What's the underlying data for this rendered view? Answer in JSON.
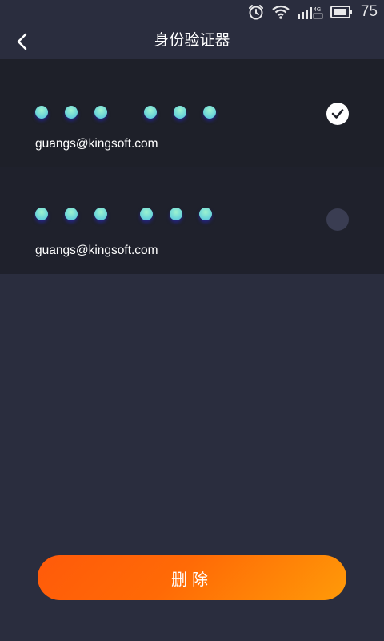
{
  "status_bar": {
    "battery_pct": "75",
    "network_label": "4G",
    "icons": [
      "alarm-icon",
      "wifi-icon",
      "signal-icon",
      "battery-icon"
    ]
  },
  "nav": {
    "title": "身份验证器",
    "back_icon": "chevron-left-icon"
  },
  "accounts": [
    {
      "email": "guangs@kingsoft.com",
      "code_masked": "••• •••",
      "selected": true
    },
    {
      "email": "guangs@kingsoft.com",
      "code_masked": "••• •••",
      "selected": false
    }
  ],
  "actions": {
    "delete_label": "删除"
  },
  "colors": {
    "background": "#2a2d3e",
    "row_selected": "#1e2029",
    "accent_orange": "#ff6a06",
    "dot_mint": "#8fecd4"
  }
}
